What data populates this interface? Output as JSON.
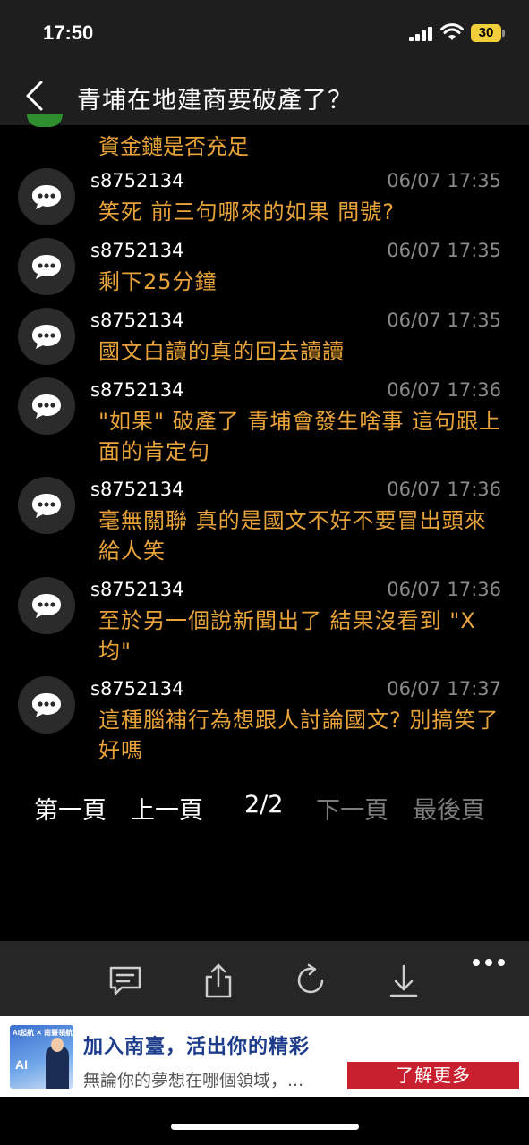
{
  "status": {
    "time": "17:50",
    "battery": "30"
  },
  "header": {
    "title": "青埔在地建商要破產了？"
  },
  "partial_post": {
    "text": "資金鏈是否充足"
  },
  "posts": [
    {
      "user": "s8752134",
      "time": "06/07 17:35",
      "text": "笑死 前三句哪來的如果 問號?"
    },
    {
      "user": "s8752134",
      "time": "06/07 17:35",
      "text": "剩下25分鐘"
    },
    {
      "user": "s8752134",
      "time": "06/07 17:35",
      "text": "國文白讀的真的回去讀讀"
    },
    {
      "user": "s8752134",
      "time": "06/07 17:36",
      "text": " \"如果\" 破產了  青埔會發生啥事  這句跟上面的肯定句"
    },
    {
      "user": "s8752134",
      "time": "06/07 17:36",
      "text": "毫無關聯   真的是國文不好不要冒出頭來給人笑"
    },
    {
      "user": "s8752134",
      "time": "06/07 17:36",
      "text": "至於另一個說新聞出了 結果沒看到 \"X均\""
    },
    {
      "user": "s8752134",
      "time": "06/07 17:37",
      "text": "這種腦補行為想跟人討論國文? 別搞笑了好嗎"
    }
  ],
  "pager": {
    "first": "第一頁",
    "prev": "上一頁",
    "current": "2/2",
    "next": "下一頁",
    "last": "最後頁"
  },
  "toolbar": {
    "icons": [
      "comment-icon",
      "share-icon",
      "refresh-icon",
      "download-icon",
      "more-icon"
    ]
  },
  "ad": {
    "title": "加入南臺，活出你的精彩",
    "description": "無論你的夢想在哪個領域，...",
    "cta": "了解更多",
    "image_header": "AI起航 ✕ 南臺領航",
    "image_text": "AI"
  },
  "colors": {
    "message": "#e8a33a",
    "timestamp": "#8a8a8a",
    "ad_cta": "#c8202f",
    "ad_title": "#1d3c8c"
  }
}
